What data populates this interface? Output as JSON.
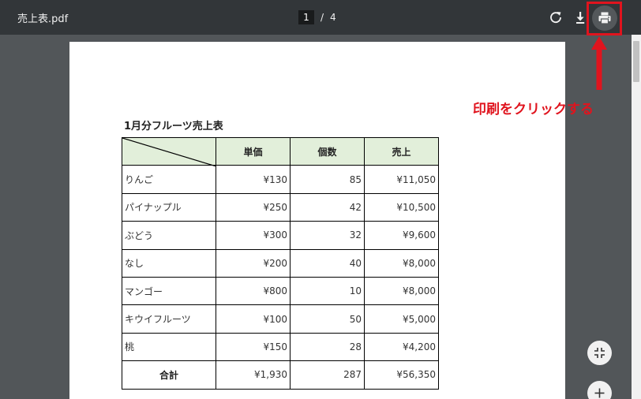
{
  "toolbar": {
    "file_name": "売上表.pdf",
    "current_page": "1",
    "page_separator": "/",
    "total_pages": "4"
  },
  "icons": {
    "rotate": "rotate-icon",
    "download": "download-icon",
    "print": "print-icon",
    "fit": "fit-to-page-icon",
    "zoom_in": "zoom-in-icon"
  },
  "document": {
    "title": "1月分フルーツ売上表",
    "headers": [
      "単価",
      "個数",
      "売上"
    ],
    "rows": [
      {
        "name": "りんご",
        "price": "¥130",
        "qty": "85",
        "sales": "¥11,050"
      },
      {
        "name": "パイナップル",
        "price": "¥250",
        "qty": "42",
        "sales": "¥10,500"
      },
      {
        "name": "ぶどう",
        "price": "¥300",
        "qty": "32",
        "sales": "¥9,600"
      },
      {
        "name": "なし",
        "price": "¥200",
        "qty": "40",
        "sales": "¥8,000"
      },
      {
        "name": "マンゴー",
        "price": "¥800",
        "qty": "10",
        "sales": "¥8,000"
      },
      {
        "name": "キウイフルーツ",
        "price": "¥100",
        "qty": "50",
        "sales": "¥5,000"
      },
      {
        "name": "桃",
        "price": "¥150",
        "qty": "28",
        "sales": "¥4,200"
      }
    ],
    "total": {
      "label": "合計",
      "price": "¥1,930",
      "qty": "287",
      "sales": "¥56,350"
    }
  },
  "annotation": {
    "text": "印刷をクリックする",
    "color": "#e0141e"
  },
  "colors": {
    "toolbar_bg": "#323639",
    "viewer_bg": "#525659",
    "header_fill": "#e2efda",
    "accent": "#e0141e"
  }
}
